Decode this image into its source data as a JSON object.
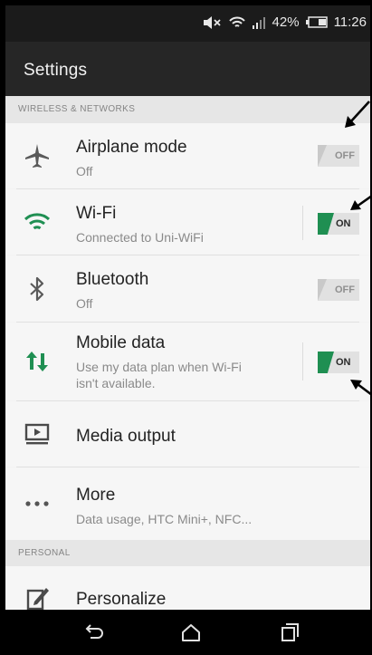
{
  "status_bar": {
    "battery_percent": "42%",
    "time": "11:26",
    "icons": [
      "volume-mute-icon",
      "wifi-icon",
      "signal-icon",
      "battery-icon"
    ]
  },
  "action_bar": {
    "title": "Settings"
  },
  "sections": {
    "wireless": "WIRELESS & NETWORKS",
    "personal": "PERSONAL"
  },
  "rows": {
    "airplane": {
      "title": "Airplane mode",
      "summary": "Off",
      "toggle": "OFF",
      "icon": "airplane-icon"
    },
    "wifi": {
      "title": "Wi-Fi",
      "summary": "Connected to Uni-WiFi",
      "toggle": "ON",
      "icon": "wifi-icon"
    },
    "bluetooth": {
      "title": "Bluetooth",
      "summary": "Off",
      "toggle": "OFF",
      "icon": "bluetooth-icon"
    },
    "mobile_data": {
      "title": "Mobile data",
      "summary_line1": "Use my data plan when Wi-Fi",
      "summary_line2": "isn't available.",
      "toggle": "ON",
      "icon": "mobile-data-icon"
    },
    "media_output": {
      "title": "Media output",
      "icon": "media-output-icon"
    },
    "more": {
      "title": "More",
      "summary": "Data usage, HTC Mini+, NFC...",
      "icon": "more-dots-icon"
    },
    "personalize": {
      "title": "Personalize",
      "icon": "personalize-icon"
    }
  },
  "nav_bar": {
    "icons": [
      "back-icon",
      "home-icon",
      "recents-icon"
    ]
  },
  "colors": {
    "accent_green": "#1f8f52",
    "status_bar": "#1b1b1b",
    "action_bar": "#262626"
  }
}
